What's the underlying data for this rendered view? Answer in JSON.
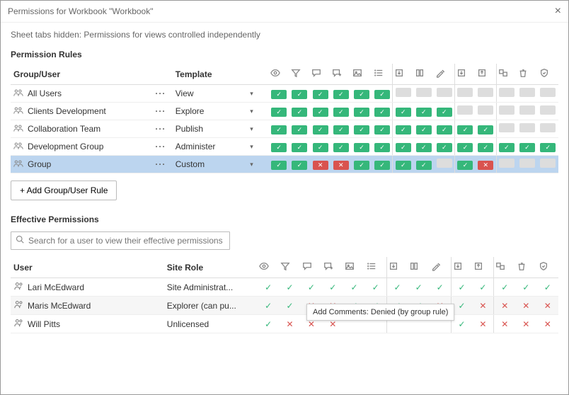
{
  "header": {
    "title": "Permissions for Workbook \"Workbook\""
  },
  "message": "Sheet tabs hidden: Permissions for views controlled independently",
  "section_rules_title": "Permission Rules",
  "columns": {
    "group": "Group/User",
    "template": "Template"
  },
  "cap_icons": [
    "view",
    "filter",
    "comment",
    "add-comment",
    "image",
    "list",
    "download",
    "pivot",
    "edit",
    "save",
    "save-as",
    "move",
    "delete",
    "permissions"
  ],
  "rules": [
    {
      "name": "All Users",
      "template": "View",
      "caps": [
        "a",
        "a",
        "a",
        "a",
        "a",
        "a",
        "n",
        "n",
        "n",
        "n",
        "n",
        "n",
        "n",
        "n"
      ],
      "selected": false
    },
    {
      "name": "Clients Development",
      "template": "Explore",
      "caps": [
        "a",
        "a",
        "a",
        "a",
        "a",
        "a",
        "a",
        "a",
        "a",
        "n",
        "n",
        "n",
        "n",
        "n"
      ],
      "selected": false
    },
    {
      "name": "Collaboration Team",
      "template": "Publish",
      "caps": [
        "a",
        "a",
        "a",
        "a",
        "a",
        "a",
        "a",
        "a",
        "a",
        "a",
        "a",
        "n",
        "n",
        "n"
      ],
      "selected": false
    },
    {
      "name": "Development Group",
      "template": "Administer",
      "caps": [
        "a",
        "a",
        "a",
        "a",
        "a",
        "a",
        "a",
        "a",
        "a",
        "a",
        "a",
        "a",
        "a",
        "a"
      ],
      "selected": false
    },
    {
      "name": "Group",
      "template": "Custom",
      "caps": [
        "a",
        "a",
        "d",
        "d",
        "a",
        "a",
        "a",
        "a",
        "n",
        "a",
        "d",
        "n",
        "n",
        "n"
      ],
      "selected": true
    }
  ],
  "add_button": "+ Add Group/User Rule",
  "effective_title": "Effective Permissions",
  "search": {
    "placeholder": "Search for a user to view their effective permissions"
  },
  "eff_columns": {
    "user": "User",
    "role": "Site Role"
  },
  "users": [
    {
      "name": "Lari McEdward",
      "role": "Site Administrat...",
      "caps": [
        "a",
        "a",
        "a",
        "a",
        "a",
        "a",
        "a",
        "a",
        "a",
        "a",
        "a",
        "a",
        "a",
        "a"
      ],
      "alt": false
    },
    {
      "name": "Maris McEdward",
      "role": "Explorer (can pu...",
      "caps": [
        "a",
        "a",
        "d",
        "d",
        "a",
        "a",
        "a",
        "a",
        "d",
        "a",
        "d",
        "d",
        "d",
        "d"
      ],
      "alt": true
    },
    {
      "name": "Will Pitts",
      "role": "Unlicensed",
      "caps": [
        "a",
        "d",
        "d",
        "d",
        "",
        "",
        "",
        "",
        "",
        "a",
        "d",
        "d",
        "d",
        "d"
      ],
      "alt": false
    }
  ],
  "tooltip": "Add Comments: Denied (by group rule)"
}
